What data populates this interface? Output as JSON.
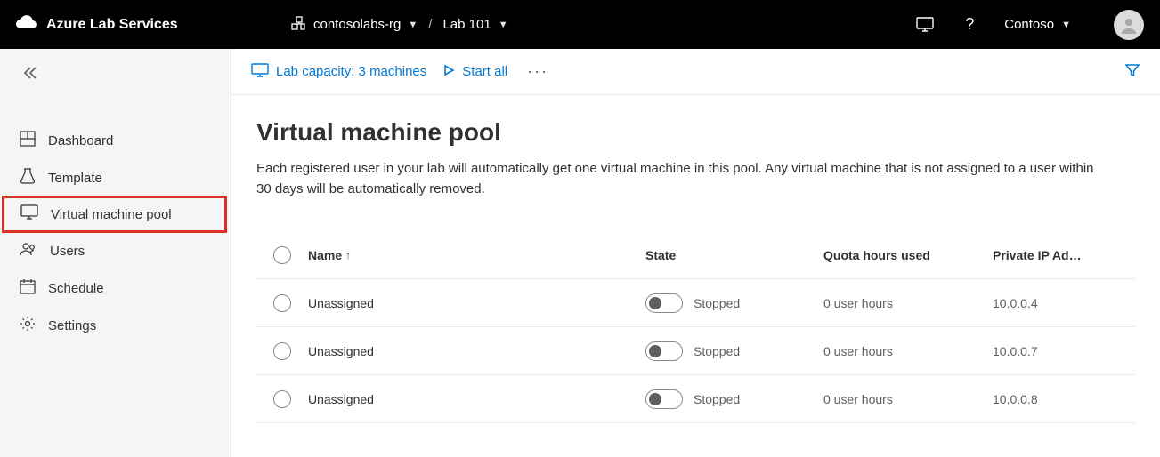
{
  "header": {
    "brand": "Azure Lab Services",
    "crumb1": "contosolabs-rg",
    "crumb2": "Lab 101",
    "user": "Contoso"
  },
  "sidebar": {
    "items": [
      {
        "label": "Dashboard"
      },
      {
        "label": "Template"
      },
      {
        "label": "Virtual machine pool"
      },
      {
        "label": "Users"
      },
      {
        "label": "Schedule"
      },
      {
        "label": "Settings"
      }
    ]
  },
  "toolbar": {
    "capacity": "Lab capacity: 3 machines",
    "startAll": "Start all"
  },
  "page": {
    "title": "Virtual machine pool",
    "description": "Each registered user in your lab will automatically get one virtual machine in this pool. Any virtual machine that is not assigned to a user within 30 days will be automatically removed."
  },
  "table": {
    "headers": {
      "name": "Name",
      "state": "State",
      "quota": "Quota hours used",
      "ip": "Private IP Ad…"
    },
    "rows": [
      {
        "name": "Unassigned",
        "state": "Stopped",
        "quota": "0 user hours",
        "ip": "10.0.0.4"
      },
      {
        "name": "Unassigned",
        "state": "Stopped",
        "quota": "0 user hours",
        "ip": "10.0.0.7"
      },
      {
        "name": "Unassigned",
        "state": "Stopped",
        "quota": "0 user hours",
        "ip": "10.0.0.8"
      }
    ]
  }
}
